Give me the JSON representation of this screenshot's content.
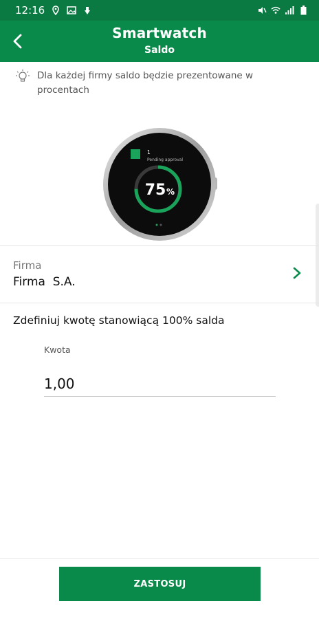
{
  "status_bar": {
    "time": "12:16",
    "left_icons": [
      "location-icon",
      "image-icon",
      "clip-icon"
    ],
    "right_icons": [
      "mute-icon",
      "wifi-icon",
      "signal-icon",
      "battery-icon"
    ]
  },
  "header": {
    "title": "Smartwatch",
    "subtitle": "Saldo",
    "back_icon": "back-arrow-icon"
  },
  "hint": {
    "icon": "lightbulb-icon",
    "text": "Dla każdej firmy saldo będzie prezentowane w procentach"
  },
  "watch_preview": {
    "count": "1",
    "status": "Pending approval",
    "percent": "75",
    "percent_sign": "%",
    "progress": 0.75
  },
  "firma": {
    "label": "Firma",
    "value": "Firma  S.A."
  },
  "define_text": "Zdefiniuj kwotę stanowiącą 100% salda",
  "kwota": {
    "label": "Kwota",
    "value": "1,00"
  },
  "apply_label": "ZASTOSUJ",
  "colors": {
    "brand": "#0a8a4a",
    "status_bar": "#0a7a42",
    "watch_ring": "#1aa35a"
  }
}
